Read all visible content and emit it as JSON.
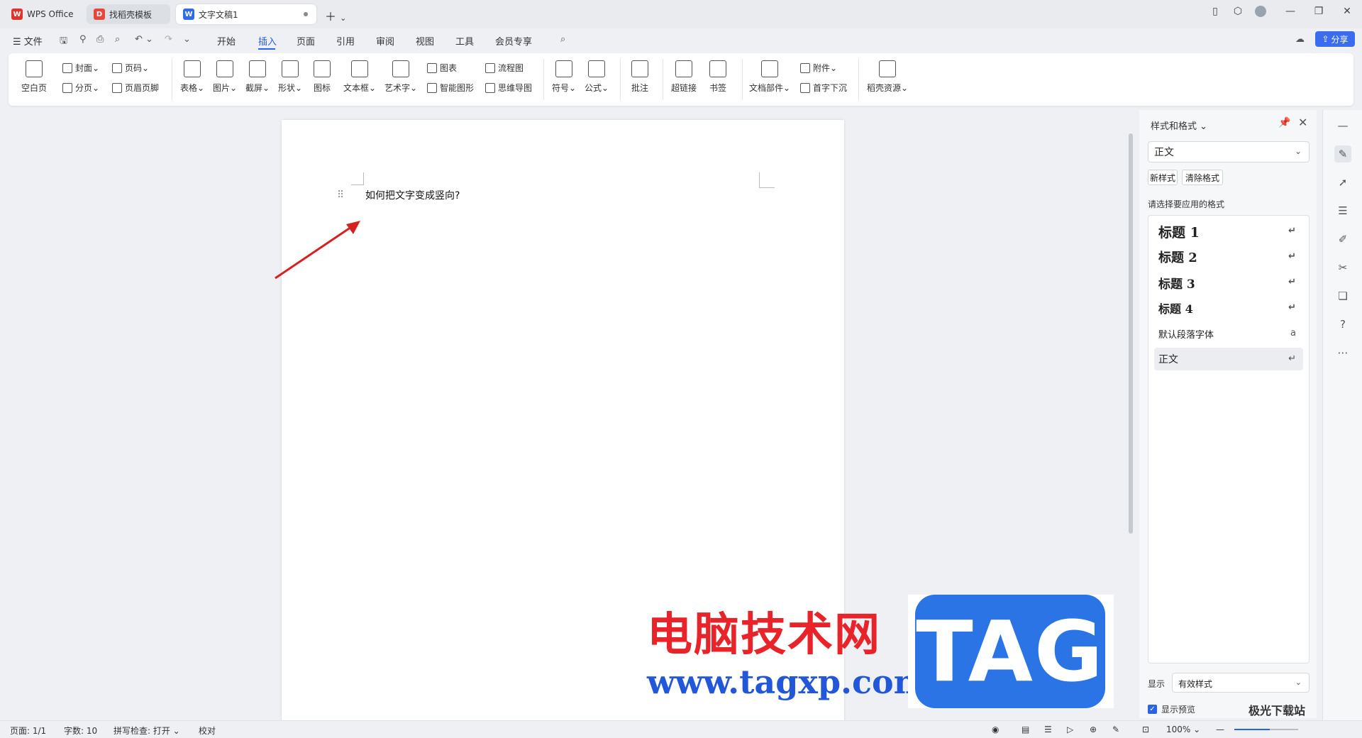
{
  "titlebar": {
    "tabs": [
      {
        "label": "WPS Office"
      },
      {
        "label": "找稻壳模板"
      },
      {
        "label": "文字文稿1"
      }
    ]
  },
  "menubar": {
    "file": "文件",
    "items": [
      "开始",
      "插入",
      "页面",
      "引用",
      "审阅",
      "视图",
      "工具",
      "会员专享"
    ],
    "active": "插入",
    "share": "分享"
  },
  "ribbon": {
    "blank_page": "空白页",
    "cover": "封面",
    "page_break": "分页",
    "page_number": "页码",
    "header_footer": "页眉页脚",
    "table": "表格",
    "picture": "图片",
    "screenshot": "截屏",
    "shape": "形状",
    "icon": "图标",
    "textbox": "文本框",
    "wordart": "艺术字",
    "chart": "图表",
    "smart_art": "智能图形",
    "flowchart": "流程图",
    "mindmap": "思维导图",
    "symbol": "符号",
    "formula": "公式",
    "comment": "批注",
    "hyperlink": "超链接",
    "bookmark": "书签",
    "doc_parts": "文档部件",
    "attachment": "附件",
    "drop_cap": "首字下沉",
    "resources": "稻壳资源"
  },
  "document": {
    "text": "如何把文字变成竖向?"
  },
  "panel": {
    "title": "样式和格式",
    "current_style": "正文",
    "new_style": "新样式",
    "clear_format": "清除格式",
    "hint": "请选择要应用的格式",
    "styles": [
      {
        "label": "标题 1"
      },
      {
        "label": "标题 2"
      },
      {
        "label": "标题 3"
      },
      {
        "label": "标题 4"
      },
      {
        "label": "默认段落字体"
      },
      {
        "label": "正文"
      }
    ],
    "show_label": "显示",
    "show_value": "有效样式",
    "preview_label": "显示预览"
  },
  "statusbar": {
    "page": "页面: 1/1",
    "words": "字数: 10",
    "spell": "拼写检查: 打开",
    "proof": "校对",
    "zoom": "100%"
  },
  "watermark": {
    "cn": "电脑技术网",
    "url": "www.tagxp.com",
    "tag": "TAG",
    "corner": "极光下载站"
  },
  "colors": {
    "accent": "#2a62e8",
    "arrow": "#d62121",
    "watermark_red": "#e8242a",
    "watermark_blue": "#2b74e6"
  }
}
